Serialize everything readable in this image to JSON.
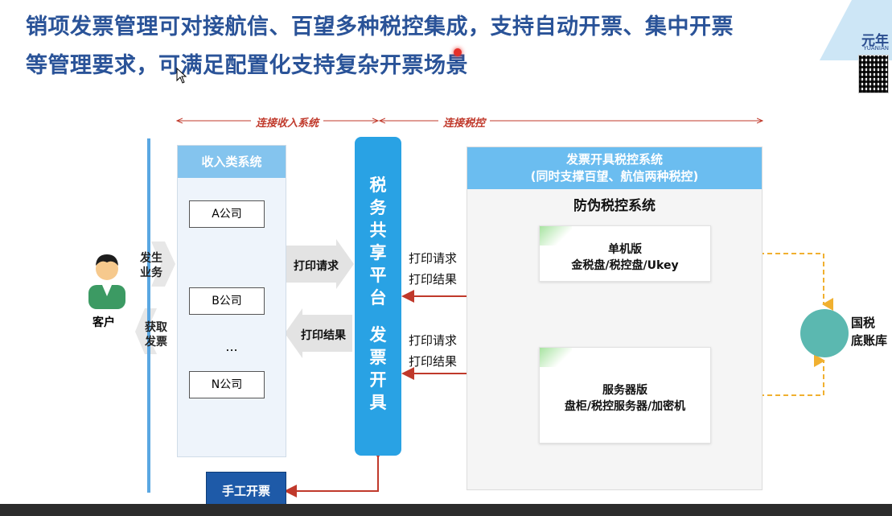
{
  "title": {
    "line1": "销项发票管理可对接航信、百望多种税控集成，支持自动开票、集中开票",
    "line2": "等管理要求，可满足配置化支持复杂开票场景"
  },
  "logo": {
    "name": "元年",
    "sub": "YUANIAN"
  },
  "top_labels": {
    "connect_income": "连接收入系统",
    "connect_tax": "连接税控"
  },
  "customer": {
    "label": "客户",
    "send": "发生业务",
    "receive": "获取发票"
  },
  "income_system": {
    "header": "收入类系统",
    "companies": [
      "A公司",
      "B公司",
      "N公司"
    ],
    "ellipsis": "..."
  },
  "gray_arrows": {
    "print_request": "打印请求",
    "print_result": "打印结果"
  },
  "platform": {
    "chars_top": [
      "税",
      "务",
      "共",
      "享",
      "平",
      "台"
    ],
    "chars_bottom": [
      "发",
      "票",
      "开",
      "具"
    ]
  },
  "red_labels": {
    "upper_request": "打印请求",
    "upper_result": "打印结果",
    "lower_request": "打印请求",
    "lower_result": "打印结果"
  },
  "tax_system": {
    "header_line1": "发票开具税控系统",
    "header_line2": "(同时支撑百望、航信两种税控)",
    "subtitle": "防伪税控系统",
    "standalone_title": "单机版",
    "standalone_desc": "金税盘/税控盘/Ukey",
    "server_title": "服务器版",
    "server_desc": "盘柜/税控服务器/加密机"
  },
  "national_db": {
    "line1": "国税",
    "line2": "底账库"
  },
  "manual": {
    "label": "手工开票"
  },
  "colors": {
    "title": "#2a5398",
    "accent_blue": "#29a2e4",
    "red_arrow": "#c0392b",
    "dashed": "#f0b030",
    "manual_bg": "#1e5aa8"
  }
}
